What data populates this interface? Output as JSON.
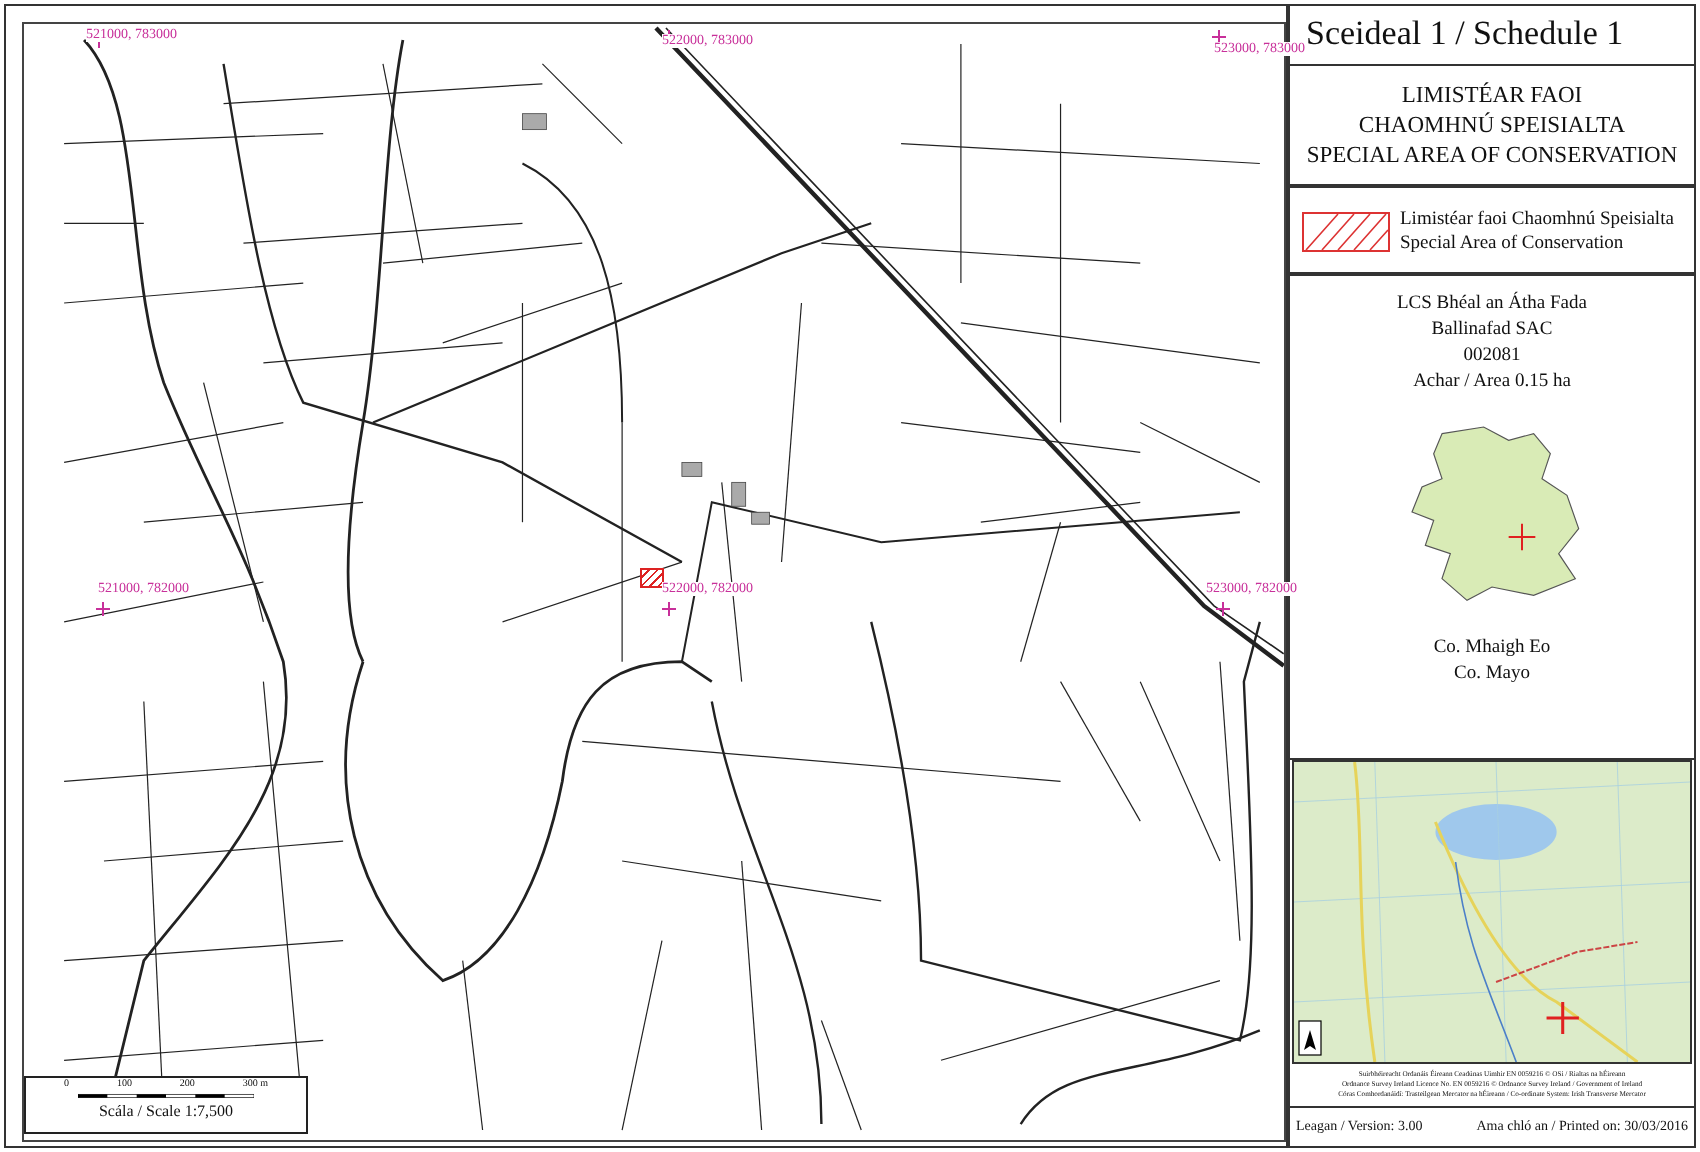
{
  "map": {
    "grid_labels": [
      {
        "text": "521000, 783000"
      },
      {
        "text": "522000, 783000"
      },
      {
        "text": "523000, 783000"
      },
      {
        "text": "521000, 782000"
      },
      {
        "text": "522000, 782000"
      },
      {
        "text": "523000, 782000"
      }
    ],
    "scale_bar": {
      "ticks": [
        "0",
        "100",
        "200",
        "300 m"
      ],
      "caption": "Scála / Scale 1:7,500"
    }
  },
  "panel": {
    "title": "Sceideal 1 / Schedule 1",
    "designation": [
      "LIMISTÉAR FAOI",
      "CHAOMHNÚ SPEISIALTA",
      "SPECIAL AREA OF CONSERVATION"
    ],
    "legend": [
      {
        "label_ga": "Limistéar faoi Chaomhnú Speisialta",
        "label_en": "Special Area of Conservation"
      }
    ],
    "site": [
      "LCS Bhéal an Átha Fada",
      "Ballinafad SAC",
      "002081",
      "Achar / Area 0.15 ha"
    ],
    "county": [
      "Co. Mhaigh Eo",
      "Co. Mayo"
    ],
    "credits": [
      "Suirbhéireacht Ordanáis Éireann Ceadúnas Uimhir EN 0059216 © OSi / Rialtas na hÉireann",
      "Ordnance Survey Ireland Licence No. EN 0059216 © Ordnance Survey Ireland / Government of Ireland",
      "Córas Comhordanáidí: Trasteilgean Mercator na hÉireann / Co-ordinate System: Irish Transverse Mercator"
    ],
    "version": "Leagan / Version: 3.00",
    "printed": "Ama chló an / Printed on: 30/03/2016"
  }
}
